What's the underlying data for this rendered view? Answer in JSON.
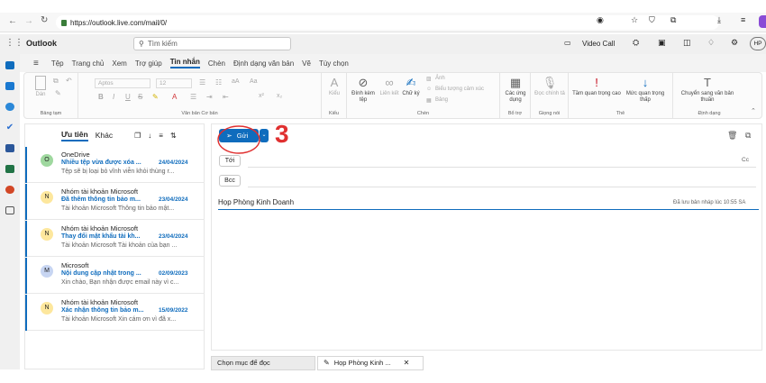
{
  "browser": {
    "url": "https://outlook.live.com/mail/0/"
  },
  "app": {
    "title": "Outlook",
    "search_placeholder": "Tìm kiếm",
    "video_call": "Video Call",
    "profile_initials": "HP"
  },
  "tabs": [
    "Tệp",
    "Trang chủ",
    "Xem",
    "Trợ giúp",
    "Tin nhắn",
    "Chèn",
    "Định dạng văn bản",
    "Vẽ",
    "Tùy chọn"
  ],
  "active_tab": "Tin nhắn",
  "ribbon": {
    "clipboard": {
      "paste": "Dán",
      "label": "Bảng tạm"
    },
    "basic_text": {
      "font": "Aptos",
      "size": "12",
      "label": "Văn bản Cơ bản"
    },
    "styles": {
      "button": "Kiểu",
      "label": "Kiểu"
    },
    "insert": {
      "attach": "Đính kèm tệp",
      "link": "Liên kết",
      "signature": "Chữ ký",
      "image": "Ảnh",
      "emoji": "Biểu tượng cảm xúc",
      "table": "Bảng",
      "label": "Chèn"
    },
    "addins": {
      "apps": "Các ứng dụng",
      "label": "Bổ trợ"
    },
    "voice": {
      "dictate": "Đọc chính tả",
      "label": "Giọng nói"
    },
    "tags": {
      "high": "Tầm quan trọng cao",
      "low": "Mức quan trọng thấp",
      "label": "Thẻ"
    },
    "format": {
      "plain": "Chuyển sang văn bản thuần",
      "label": "Định dạng"
    }
  },
  "list": {
    "tab_focused": "Ưu tiên",
    "tab_other": "Khác",
    "messages": [
      {
        "initial": "O",
        "sender": "OneDrive",
        "subject": "Nhiều tệp vừa được xóa ...",
        "date": "24/04/2024",
        "preview": "Tệp sẽ bị loại bỏ vĩnh viễn khỏi thùng r...",
        "avatar_color": "#9fd89f"
      },
      {
        "initial": "N",
        "sender": "Nhóm tài khoản Microsoft",
        "subject": "Đã thêm thông tin bảo m...",
        "date": "23/04/2024",
        "preview": "Tài khoản Microsoft Thông tin bảo mật...",
        "avatar_color": "#fde79d"
      },
      {
        "initial": "N",
        "sender": "Nhóm tài khoản Microsoft",
        "subject": "Thay đổi mật khẩu tài kh...",
        "date": "23/04/2024",
        "preview": "Tài khoản Microsoft Tài khoản của bạn ...",
        "avatar_color": "#fde79d"
      },
      {
        "initial": "M",
        "sender": "Microsoft",
        "subject": "Nội dung cập nhật trong ...",
        "date": "02/09/2023",
        "preview": "Xin chào, Bạn nhận được email này vì c...",
        "avatar_color": "#c7d5f2"
      },
      {
        "initial": "N",
        "sender": "Nhóm tài khoản Microsoft",
        "subject": "Xác nhận thông tin bảo m...",
        "date": "15/09/2022",
        "preview": "Tài khoản Microsoft Xin cám ơn vì đã x...",
        "avatar_color": "#fde79d"
      }
    ]
  },
  "compose": {
    "send": "Gửi",
    "to": "Tới",
    "cc": "Cc",
    "bcc": "Bcc",
    "subject": "Họp Phòng Kinh Doanh",
    "draft_saved": "Đã lưu bản nháp lúc 10:55 SA"
  },
  "annotation": {
    "number": "3",
    "color": "#e03030"
  },
  "bottom": {
    "read_tab": "Chọn mục để đọc",
    "draft_tab": "Họp Phòng Kinh ..."
  },
  "colors": {
    "accent": "#0f6cbd"
  }
}
